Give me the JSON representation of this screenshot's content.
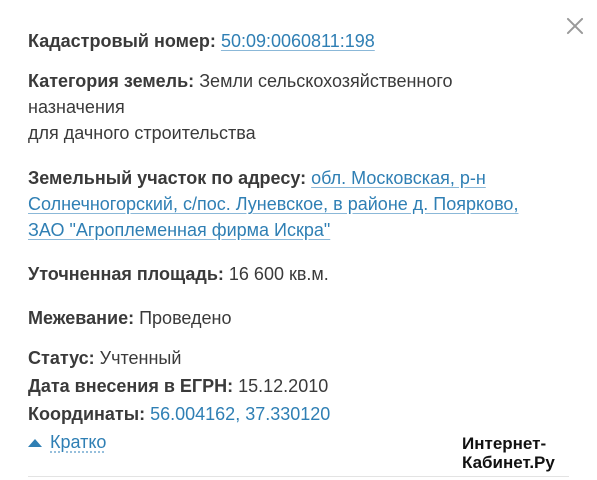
{
  "cadastral": {
    "label": "Кадастровый номер:",
    "value": "50:09:0060811:198"
  },
  "category": {
    "label": "Категория земель:",
    "value_line1": "Земли сельскохозяйственного",
    "value_line2": "назначения",
    "value_line3": "для дачного строительства"
  },
  "address": {
    "label": "Земельный участок по адресу:",
    "line1": "обл. Московская, р-н",
    "line2": "Солнечногорский, с/пос. Луневское, в районе д. Поярково,",
    "line3": "ЗАО \"Агроплеменная фирма Искра\""
  },
  "area": {
    "label": "Уточненная площадь:",
    "value": "16 600 кв.м."
  },
  "survey": {
    "label": "Межевание:",
    "value": "Проведено"
  },
  "status": {
    "label": "Статус:",
    "value": "Учтенный"
  },
  "egrn_date": {
    "label": "Дата внесения в ЕГРН:",
    "value": "15.12.2010"
  },
  "coordinates": {
    "label": "Координаты:",
    "value": "56.004162, 37.330120"
  },
  "collapse": {
    "label": "Кратко"
  },
  "watermark": {
    "line1": "Интернет-",
    "line2": "Кабинет.Ру"
  },
  "colors": {
    "link": "#2f7fb4",
    "text": "#3a3a3a",
    "close": "#9a9a9a"
  },
  "icons": {
    "close": "close-icon",
    "collapse": "triangle-up-icon"
  }
}
